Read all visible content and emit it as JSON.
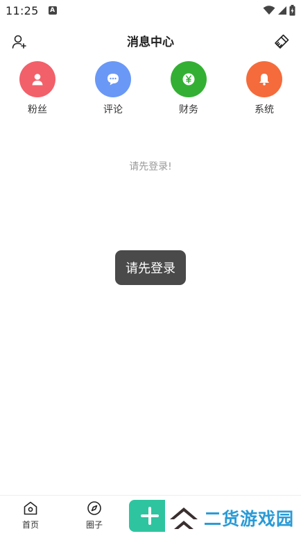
{
  "status_bar": {
    "time": "11:25",
    "notification_glyph": "A"
  },
  "header": {
    "title": "消息中心",
    "left_icon": "add-user-icon",
    "right_icon": "clear-broom-icon"
  },
  "categories": [
    {
      "label": "粉丝",
      "icon": "fans-icon",
      "color": "#f2606a"
    },
    {
      "label": "评论",
      "icon": "comment-icon",
      "color": "#6a98f6"
    },
    {
      "label": "财务",
      "icon": "finance-icon",
      "color": "#33b033"
    },
    {
      "label": "系统",
      "icon": "bell-icon",
      "color": "#f56b3b"
    }
  ],
  "empty_message": "请先登录!",
  "toast": "请先登录",
  "tabbar": {
    "items": [
      {
        "label": "首页",
        "icon": "home-icon"
      },
      {
        "label": "圈子",
        "icon": "compass-icon"
      }
    ],
    "fab_icon": "plus-icon",
    "fab_color": "#2ec4a0"
  },
  "watermark": {
    "text": "二货游戏园",
    "color": "#2a9bd6"
  }
}
